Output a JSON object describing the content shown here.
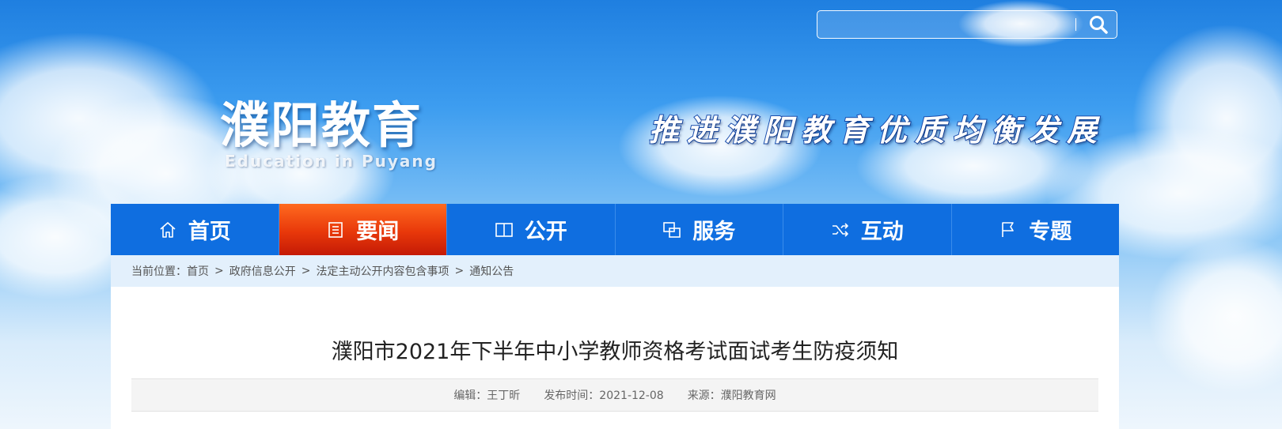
{
  "search": {
    "value": "",
    "placeholder": ""
  },
  "logo": {
    "cn": "濮阳教育",
    "en": "Education in Puyang"
  },
  "slogan": "推进濮阳教育优质均衡发展",
  "nav": {
    "items": [
      {
        "label": "首页",
        "icon": "home-icon"
      },
      {
        "label": "要闻",
        "icon": "document-icon",
        "active": true
      },
      {
        "label": "公开",
        "icon": "open-book-icon"
      },
      {
        "label": "服务",
        "icon": "service-icon"
      },
      {
        "label": "互动",
        "icon": "shuffle-icon"
      },
      {
        "label": "专题",
        "icon": "flag-icon"
      }
    ]
  },
  "breadcrumb": {
    "prefix": "当前位置：",
    "items": [
      "首页",
      "政府信息公开",
      "法定主动公开内容包含事项",
      "通知公告"
    ],
    "separator": ">"
  },
  "article": {
    "title": "濮阳市2021年下半年中小学教师资格考试面试考生防疫须知",
    "editor": "编辑：王丁昕",
    "date": "发布时间：2021-12-08",
    "source": "来源：濮阳教育网"
  },
  "colors": {
    "nav_bg": "#0f6ee0",
    "nav_active": "#e8380a",
    "breadcrumb_bg": "#e3f0fc",
    "sky": "#3d9df0"
  }
}
